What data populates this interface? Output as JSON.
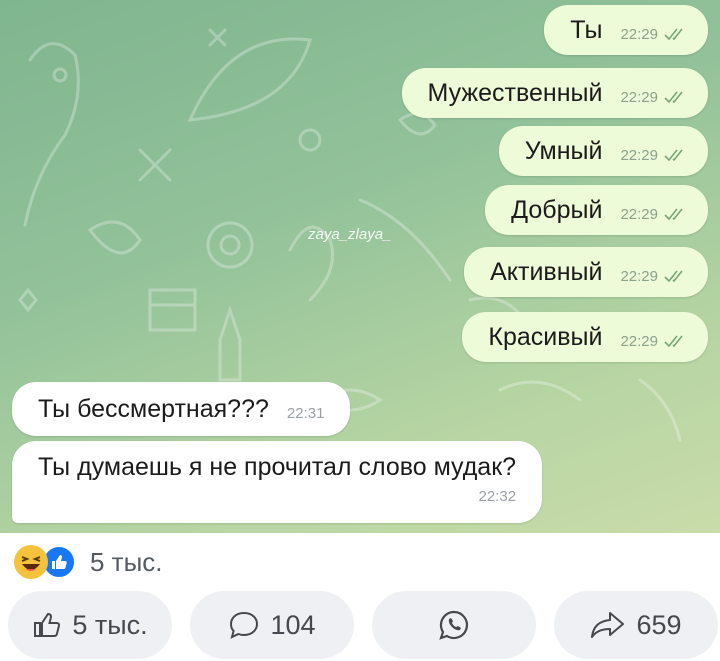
{
  "chat": {
    "watermark": "zaya_zlaya_",
    "outgoing": [
      {
        "text": "Ты",
        "time": "22:29"
      },
      {
        "text": "Мужественный",
        "time": "22:29"
      },
      {
        "text": "Умный",
        "time": "22:29"
      },
      {
        "text": "Добрый",
        "time": "22:29"
      },
      {
        "text": "Активный",
        "time": "22:29"
      },
      {
        "text": "Красивый",
        "time": "22:29"
      }
    ],
    "incoming": [
      {
        "text": "Ты бессмертная???",
        "time": "22:31"
      },
      {
        "text": "Ты думаешь я не прочитал слово мудак?",
        "time": "22:32"
      }
    ]
  },
  "reactions": {
    "count": "5 тыс."
  },
  "actions": {
    "like": "5 тыс.",
    "comments": "104",
    "share": "659"
  },
  "colors": {
    "outgoing_bubble": "#eefbd8",
    "incoming_bubble": "#ffffff",
    "like_blue": "#1877f2"
  }
}
